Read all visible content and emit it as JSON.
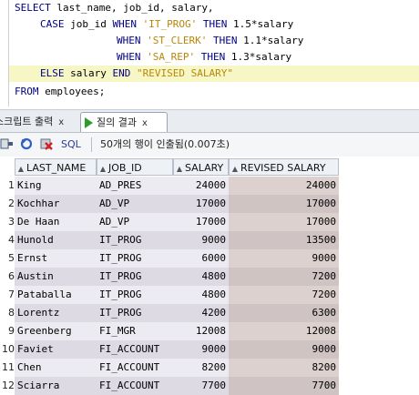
{
  "editor": {
    "line1": {
      "kw1": "SELECT",
      "rest": " last_name, job_id, salary,"
    },
    "line2": {
      "kw1": "CASE",
      "a": " job_id ",
      "kw2": "WHEN",
      "s": " 'IT_PROG' ",
      "kw3": "THEN",
      "b": " 1.5*salary"
    },
    "line3": {
      "kw2": "WHEN",
      "s": " 'ST_CLERK' ",
      "kw3": "THEN",
      "b": " 1.1*salary"
    },
    "line4": {
      "kw2": "WHEN",
      "s": " 'SA_REP' ",
      "kw3": "THEN",
      "b": " 1.3*salary"
    },
    "line5": {
      "kw1": "ELSE",
      "a": " salary ",
      "kw2": "END",
      "s": " \"REVISED SALARY\""
    },
    "line6": {
      "kw1": "FROM",
      "rest": " employees;"
    }
  },
  "tabs": {
    "script_output": "스크립트 출력",
    "script_output_close": "x",
    "query_result": "질의 결과",
    "query_result_close": "x"
  },
  "toolbar": {
    "sql_label": "SQL",
    "status": "50개의 행이 인출됨(0.007초)"
  },
  "grid": {
    "columns": [
      "LAST_NAME",
      "JOB_ID",
      "SALARY",
      "REVISED SALARY"
    ],
    "rows": [
      {
        "n": "1",
        "last_name": "King",
        "job_id": "AD_PRES",
        "salary": "24000",
        "revised": "24000"
      },
      {
        "n": "2",
        "last_name": "Kochhar",
        "job_id": "AD_VP",
        "salary": "17000",
        "revised": "17000"
      },
      {
        "n": "3",
        "last_name": "De Haan",
        "job_id": "AD_VP",
        "salary": "17000",
        "revised": "17000"
      },
      {
        "n": "4",
        "last_name": "Hunold",
        "job_id": "IT_PROG",
        "salary": "9000",
        "revised": "13500"
      },
      {
        "n": "5",
        "last_name": "Ernst",
        "job_id": "IT_PROG",
        "salary": "6000",
        "revised": "9000"
      },
      {
        "n": "6",
        "last_name": "Austin",
        "job_id": "IT_PROG",
        "salary": "4800",
        "revised": "7200"
      },
      {
        "n": "7",
        "last_name": "Pataballa",
        "job_id": "IT_PROG",
        "salary": "4800",
        "revised": "7200"
      },
      {
        "n": "8",
        "last_name": "Lorentz",
        "job_id": "IT_PROG",
        "salary": "4200",
        "revised": "6300"
      },
      {
        "n": "9",
        "last_name": "Greenberg",
        "job_id": "FI_MGR",
        "salary": "12008",
        "revised": "12008"
      },
      {
        "n": "10",
        "last_name": "Faviet",
        "job_id": "FI_ACCOUNT",
        "salary": "9000",
        "revised": "9000"
      },
      {
        "n": "11",
        "last_name": "Chen",
        "job_id": "FI_ACCOUNT",
        "salary": "8200",
        "revised": "8200"
      },
      {
        "n": "12",
        "last_name": "Sciarra",
        "job_id": "FI_ACCOUNT",
        "salary": "7700",
        "revised": "7700"
      }
    ]
  },
  "colors": {
    "keyword": "#000080",
    "string": "#b8860b",
    "row_even": "#ecebf2",
    "row_odd": "#dedae3",
    "selected_col_even": "#dcd1cf",
    "selected_col_odd": "#cfc4c3",
    "highlight_line": "#f7f7c6"
  },
  "icons": [
    "pin-icon",
    "refresh-icon",
    "cancel-icon"
  ]
}
